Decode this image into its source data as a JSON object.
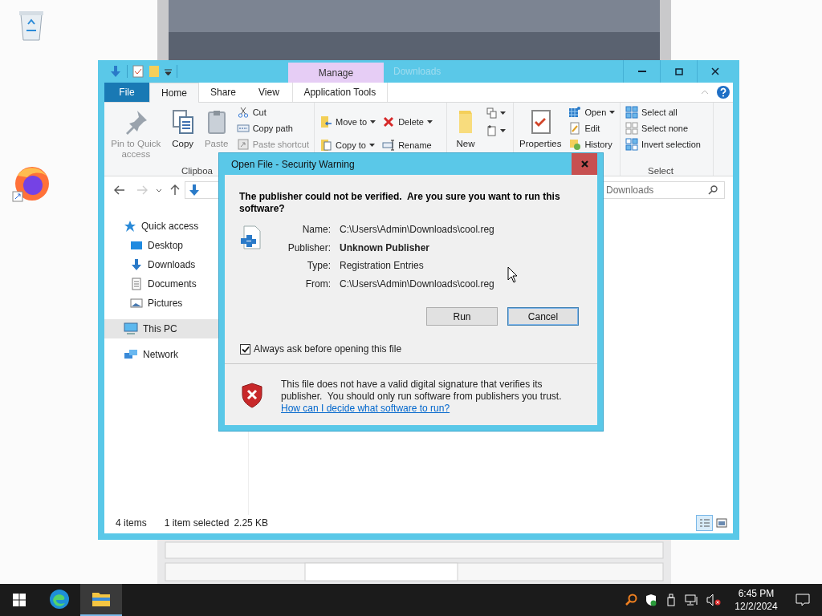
{
  "explorer": {
    "title": "Downloads",
    "contextual_tab": "Manage",
    "tabs": [
      {
        "label": "File",
        "kind": "file",
        "selected": false
      },
      {
        "label": "Home",
        "kind": "tab",
        "selected": true
      },
      {
        "label": "Share",
        "kind": "tab",
        "selected": false
      },
      {
        "label": "View",
        "kind": "tab",
        "selected": false
      },
      {
        "label": "Application Tools",
        "kind": "contextual",
        "selected": false
      }
    ],
    "ribbon": [
      {
        "label": "Clipboa",
        "items": [
          {
            "kind": "large",
            "label": "Pin to Quick access",
            "disabled": true,
            "dropdown": false
          },
          {
            "kind": "large",
            "label": "Copy",
            "disabled": false,
            "dropdown": false
          },
          {
            "kind": "large",
            "label": "Paste",
            "disabled": true,
            "dropdown": false
          },
          {
            "kind": "small",
            "label": "Cut",
            "disabled": false,
            "dropdown": false
          },
          {
            "kind": "small",
            "label": "Copy path",
            "disabled": false,
            "dropdown": false
          },
          {
            "kind": "small",
            "label": "Paste shortcut",
            "disabled": true,
            "dropdown": false
          }
        ]
      },
      {
        "items": [
          {
            "kind": "medium",
            "label": "Move to",
            "disabled": false,
            "dropdown": true
          },
          {
            "kind": "medium",
            "label": "Copy to",
            "disabled": false,
            "dropdown": true
          },
          {
            "kind": "medium",
            "label": "Delete",
            "disabled": false,
            "dropdown": true
          },
          {
            "kind": "medium",
            "label": "Rename",
            "disabled": false,
            "dropdown": false
          }
        ]
      },
      {
        "items": [
          {
            "kind": "large",
            "label": "New",
            "disabled": false,
            "dropdown": false
          },
          {
            "kind": "icon",
            "disabled": false,
            "dropdown": true
          },
          {
            "kind": "icon",
            "disabled": false,
            "dropdown": true
          }
        ]
      },
      {
        "items": [
          {
            "kind": "large",
            "label": "Properties",
            "disabled": false,
            "dropdown": false
          },
          {
            "kind": "small",
            "label": "Open",
            "disabled": false,
            "dropdown": true
          },
          {
            "kind": "small",
            "label": "Edit",
            "disabled": false,
            "dropdown": false
          },
          {
            "kind": "small",
            "label": "History",
            "disabled": false,
            "dropdown": false
          }
        ]
      },
      {
        "label": "Select",
        "items": [
          {
            "kind": "small",
            "label": "Select all",
            "disabled": false,
            "dropdown": false
          },
          {
            "kind": "small",
            "label": "Select none",
            "disabled": false,
            "dropdown": false
          },
          {
            "kind": "small",
            "label": "Invert selection",
            "disabled": false,
            "dropdown": false
          }
        ]
      }
    ],
    "search_placeholder": "Downloads",
    "sidebar": [
      {
        "label": "Quick access",
        "selected": false,
        "children": [
          {
            "label": "Desktop",
            "selected": false
          },
          {
            "label": "Downloads",
            "selected": false
          },
          {
            "label": "Documents",
            "selected": false
          },
          {
            "label": "Pictures",
            "selected": false
          }
        ]
      },
      {
        "label": "This PC",
        "selected": true
      },
      {
        "label": "Network",
        "selected": false
      }
    ],
    "status_bar": {
      "count": "4 items",
      "selection": "1 item selected",
      "size": "2.25 KB"
    },
    "view_buttons": [
      {
        "kind": "details",
        "selected": true
      },
      {
        "kind": "large_icons",
        "selected": false
      }
    ]
  },
  "dialog": {
    "title": "Open File - Security Warning",
    "heading": "The publisher could not be verified.  Are you sure you want to run this software?",
    "fields": [
      {
        "label": "Name:",
        "value": "C:\\Users\\Admin\\Downloads\\cool.reg",
        "bold": false
      },
      {
        "label": "Publisher:",
        "value": "Unknown Publisher",
        "bold": true
      },
      {
        "label": "Type:",
        "value": "Registration Entries",
        "bold": false
      },
      {
        "label": "From:",
        "value": "C:\\Users\\Admin\\Downloads\\cool.reg",
        "bold": false
      }
    ],
    "buttons": [
      {
        "label": "Run",
        "focused": false
      },
      {
        "label": "Cancel",
        "focused": true
      }
    ],
    "checkbox": {
      "label": "Always ask before opening this file",
      "checked": true
    },
    "warning": "This file does not have a valid digital signature that verifies its publisher.  You should only run software from publishers you trust.",
    "link": "How can I decide what software to run?"
  },
  "taskbar": {
    "apps": [
      {
        "kind": "edge",
        "selected": false
      },
      {
        "kind": "explorer",
        "selected": true
      }
    ],
    "time": "6:45 PM",
    "date": "12/2/2024"
  }
}
